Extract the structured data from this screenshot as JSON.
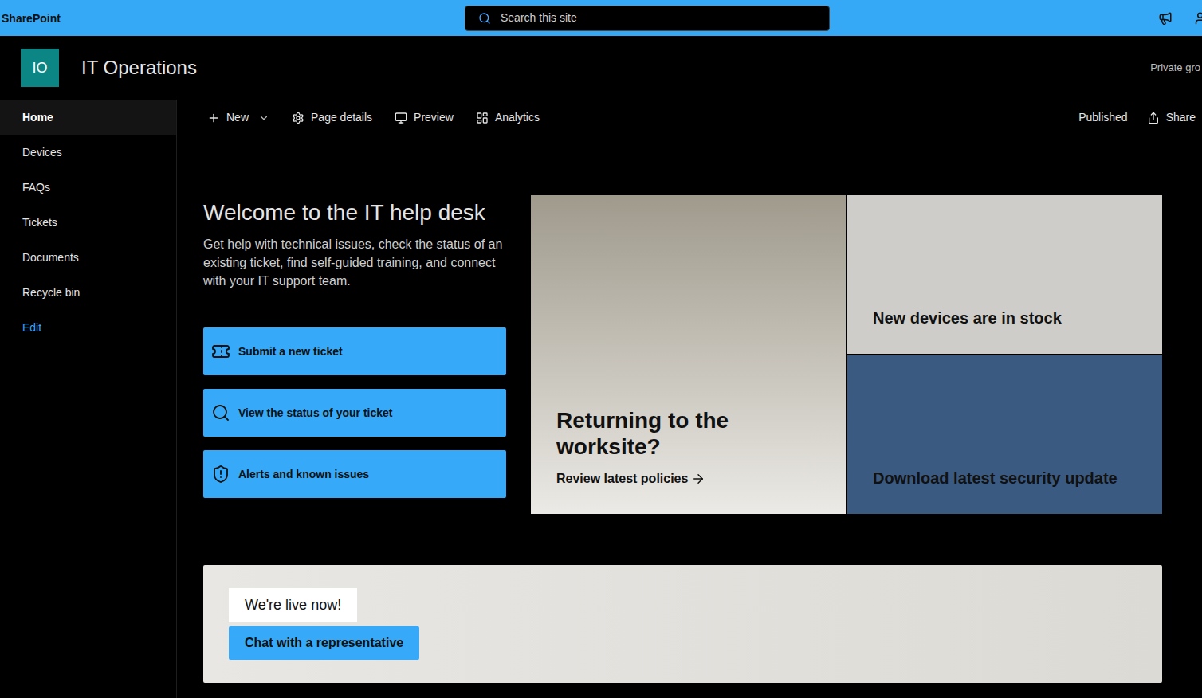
{
  "top_bar": {
    "app_name": "SharePoint",
    "search": {
      "placeholder": "Search this site"
    }
  },
  "site_header": {
    "logo_initials": "IO",
    "title": "IT Operations",
    "privacy": "Private gro"
  },
  "sidebar": {
    "items": [
      {
        "label": "Home",
        "selected": true,
        "kind": "page"
      },
      {
        "label": "Devices",
        "selected": false,
        "kind": "page"
      },
      {
        "label": "FAQs",
        "selected": false,
        "kind": "page"
      },
      {
        "label": "Tickets",
        "selected": false,
        "kind": "page"
      },
      {
        "label": "Documents",
        "selected": false,
        "kind": "page"
      },
      {
        "label": "Recycle bin",
        "selected": false,
        "kind": "page"
      },
      {
        "label": "Edit",
        "selected": false,
        "kind": "link"
      }
    ]
  },
  "command_bar": {
    "items": [
      {
        "label": "New",
        "kind": "new",
        "has_dropdown": true
      },
      {
        "label": "Page details",
        "kind": "details",
        "has_dropdown": false
      },
      {
        "label": "Preview",
        "kind": "preview",
        "has_dropdown": false
      },
      {
        "label": "Analytics",
        "kind": "analytics",
        "has_dropdown": false
      }
    ],
    "status": "Published",
    "share": "Share"
  },
  "welcome": {
    "heading": "Welcome to the IT help desk",
    "body": "Get help with technical issues, check the status of an existing ticket, find self-guided training, and connect with your IT support team.",
    "buttons": [
      {
        "label": "Submit a new ticket",
        "kind": "ticket"
      },
      {
        "label": "View the status of your ticket",
        "kind": "search"
      },
      {
        "label": "Alerts and known issues",
        "kind": "alert"
      }
    ]
  },
  "hero": {
    "tiles": [
      {
        "title": "Returning to the worksite?",
        "link": "Review latest policies",
        "kind": "large",
        "color": "#d8d5cd"
      },
      {
        "title": "New devices are in stock",
        "link": "",
        "kind": "small",
        "color": "#cfcdc9"
      },
      {
        "title": "Download latest security update",
        "link": "",
        "kind": "small",
        "color": "#3a5a82"
      }
    ]
  },
  "banner": {
    "badge": "We're live now!",
    "button": "Chat with a representative"
  }
}
